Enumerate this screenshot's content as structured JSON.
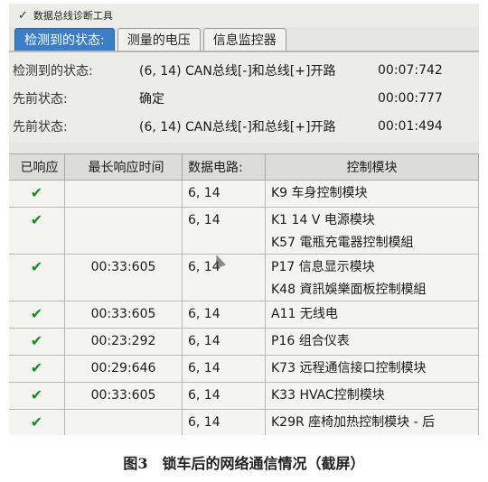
{
  "window": {
    "title": "数据总线诊断工具"
  },
  "tabs": [
    {
      "label": "检测到的状态:"
    },
    {
      "label": "测量的电压"
    },
    {
      "label": "信息监控器"
    }
  ],
  "status": [
    {
      "label": "检测到的状态:",
      "text": "(6, 14) CAN总线[-]和总线[+]开路",
      "time": "00:07:742"
    },
    {
      "label": "先前状态:",
      "text": "确定",
      "time": "00:00:777"
    },
    {
      "label": "先前状态:",
      "text": "(6, 14) CAN总线[-]和总线[+]开路",
      "time": "00:01:494"
    }
  ],
  "table": {
    "headers": [
      "已响应",
      "最长响应时间",
      "数据电路:",
      "控制模块"
    ],
    "rows": [
      {
        "responded": "✔",
        "time": "",
        "circuit": "6, 14",
        "modules": [
          "K9 车身控制模块"
        ]
      },
      {
        "responded": "✔",
        "time": "",
        "circuit": "6, 14",
        "modules": [
          "K1 14 V 电源模块",
          "K57 電瓶充電器控制模組"
        ]
      },
      {
        "responded": "✔",
        "time": "00:33:605",
        "circuit": "6, 14",
        "modules": [
          "P17 信息显示模块",
          "K48 資訊娛樂面板控制模組"
        ]
      },
      {
        "responded": "✔",
        "time": "00:33:605",
        "circuit": "6, 14",
        "modules": [
          "A11 无线电"
        ]
      },
      {
        "responded": "✔",
        "time": "00:23:292",
        "circuit": "6, 14",
        "modules": [
          "P16 组合仪表"
        ]
      },
      {
        "responded": "✔",
        "time": "00:29:646",
        "circuit": "6, 14",
        "modules": [
          "K73 远程通信接口控制模块"
        ]
      },
      {
        "responded": "✔",
        "time": "00:33:605",
        "circuit": "6, 14",
        "modules": [
          "K33 HVAC控制模块"
        ]
      },
      {
        "responded": "✔",
        "time": "",
        "circuit": "6, 14",
        "modules": [
          "K29R 座椅加热控制模块 - 后"
        ]
      }
    ]
  },
  "caption": "图3　锁车后的网络通信情况（截屏）",
  "colors": {
    "active_tab": "#3a7ec8",
    "check": "#1c8a1c"
  }
}
